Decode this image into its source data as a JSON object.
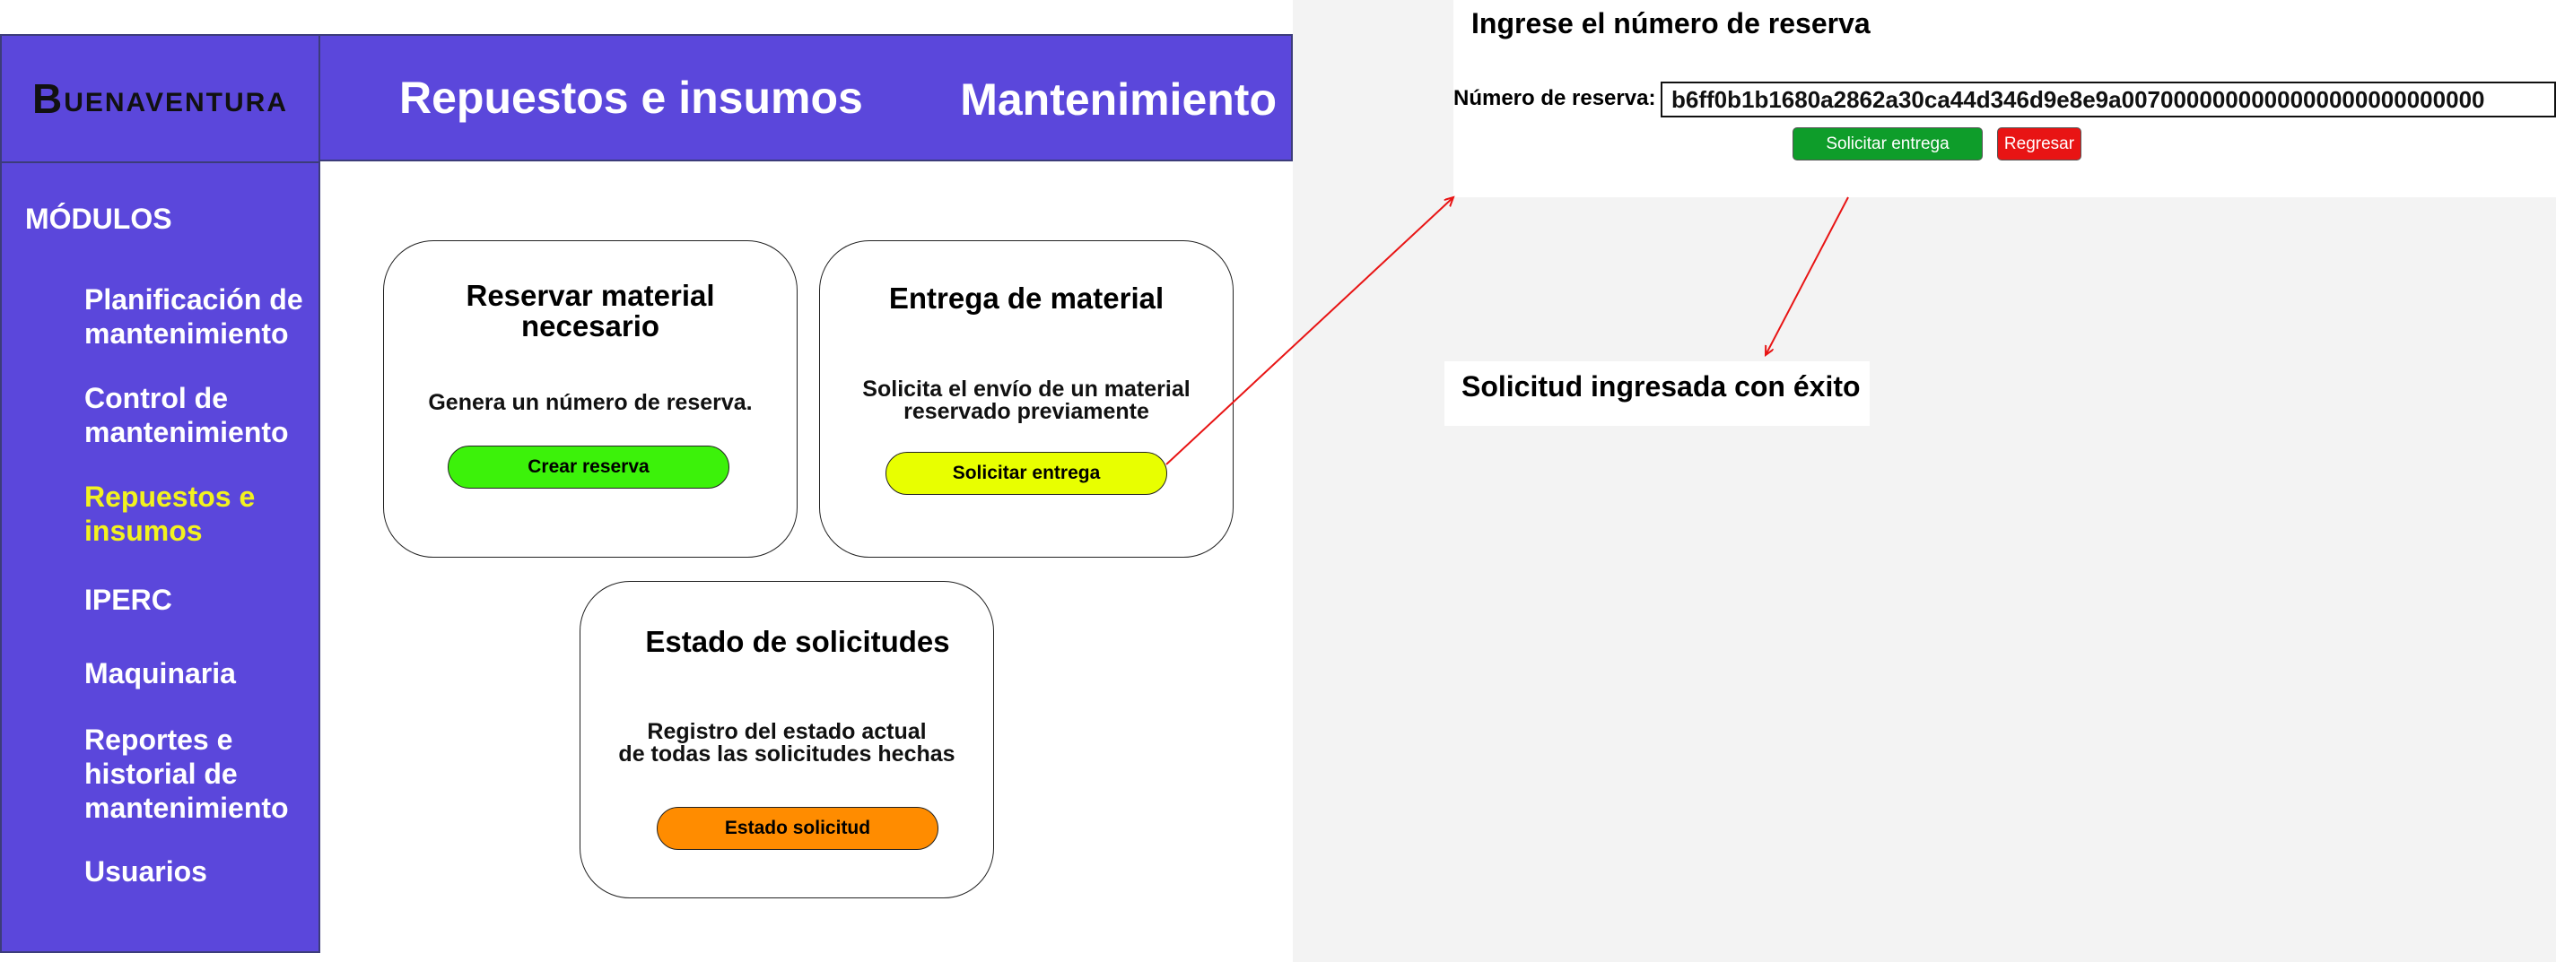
{
  "sidebar": {
    "logo_initial": "B",
    "logo_rest": "UENAVENTURA",
    "modules_title": "MÓDULOS",
    "items": [
      {
        "label_line1": "Planificación de",
        "label_line2": "mantenimiento"
      },
      {
        "label_line1": "Control de",
        "label_line2": "mantenimiento"
      },
      {
        "label_line1": "Repuestos e",
        "label_line2": "insumos"
      },
      {
        "label_line1": "IPERC",
        "label_line2": ""
      },
      {
        "label_line1": "Maquinaria",
        "label_line2": ""
      },
      {
        "label_line1": "Reportes e",
        "label_line2": "historial de",
        "label_line3": "mantenimiento"
      },
      {
        "label_line1": "Usuarios",
        "label_line2": ""
      }
    ],
    "active_item": "Repuestos e insumos"
  },
  "header": {
    "title": "Repuestos e insumos",
    "section": "Mantenimiento"
  },
  "cards": {
    "reserve": {
      "title_line1": "Reservar material",
      "title_line2": "necesario",
      "description": "Genera un número de reserva.",
      "button": "Crear reserva"
    },
    "delivery": {
      "title": "Entrega de material",
      "description_line1": "Solicita el envío de un material",
      "description_line2": "reservado previamente",
      "button": "Solicitar entrega"
    },
    "status": {
      "title": "Estado de solicitudes",
      "description_line1": "Registro del estado actual",
      "description_line2": "de todas las solicitudes hechas",
      "button": "Estado solicitud"
    }
  },
  "delivery_panel": {
    "heading": "Ingrese el número de reserva",
    "field_label": "Número de reserva:",
    "field_value": "b6ff0b1b1680a2862a30ca44d346d9e8e9a0070000000000000000000000000",
    "submit_button": "Solicitar entrega",
    "back_button": "Regresar"
  },
  "success": {
    "message": "Solicitud ingresada con éxito"
  },
  "colors": {
    "brand": "#5b47db",
    "active_nav": "#f2f21f",
    "btn_reserve": "#3cf20a",
    "btn_delivery": "#e8ff00",
    "btn_status": "#ff8c00",
    "btn_submit": "#0e9d2a",
    "btn_back": "#e81414",
    "arrow": "#e81414"
  }
}
